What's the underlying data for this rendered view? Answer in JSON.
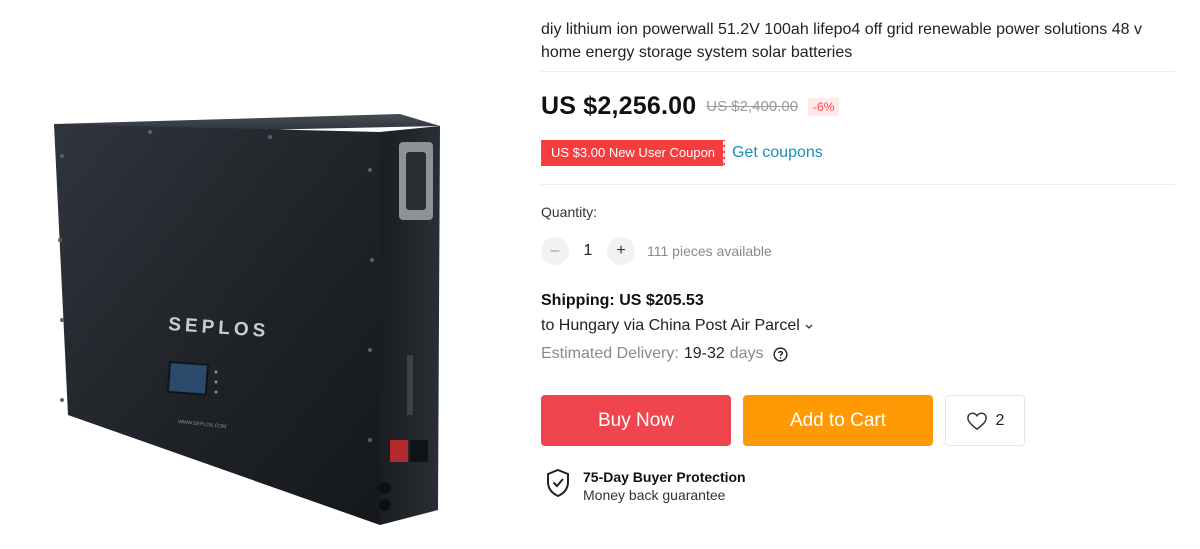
{
  "product": {
    "title": "diy lithium ion powerwall 51.2V 100ah lifepo4 off grid renewable power solutions 48 v home energy storage system solar batteries",
    "image": {
      "brand_text": "SEPLOS",
      "url_text": "WWW.SEPLOS.COM"
    }
  },
  "price": {
    "current": "US $2,256.00",
    "original": "US $2,400.00",
    "discount": "-6%"
  },
  "coupon": {
    "tag": "US $3.00 New User Coupon",
    "link": "Get coupons"
  },
  "quantity": {
    "label": "Quantity:",
    "minus": "–",
    "value": "1",
    "plus": "+",
    "available": "111 pieces available"
  },
  "shipping": {
    "title": "Shipping: US $205.53",
    "route": "to Hungary via China Post Air Parcel",
    "delivery_label": "Estimated Delivery:",
    "delivery_value": "19-32",
    "delivery_unit": "days"
  },
  "actions": {
    "buy_now": "Buy Now",
    "add_to_cart": "Add to Cart",
    "wishlist_count": "2"
  },
  "protection": {
    "title": "75-Day Buyer Protection",
    "subtitle": "Money back guarantee"
  },
  "icons": {
    "chevron": "chevron-down-icon",
    "help": "question-circle-icon",
    "heart": "heart-outline-icon",
    "shield": "shield-check-icon"
  },
  "colors": {
    "buy_now": "#f0454f",
    "add_to_cart": "#ff9a06",
    "coupon": "#f53d3d",
    "link": "#1a8fb8",
    "discount_text": "#ff4747"
  }
}
